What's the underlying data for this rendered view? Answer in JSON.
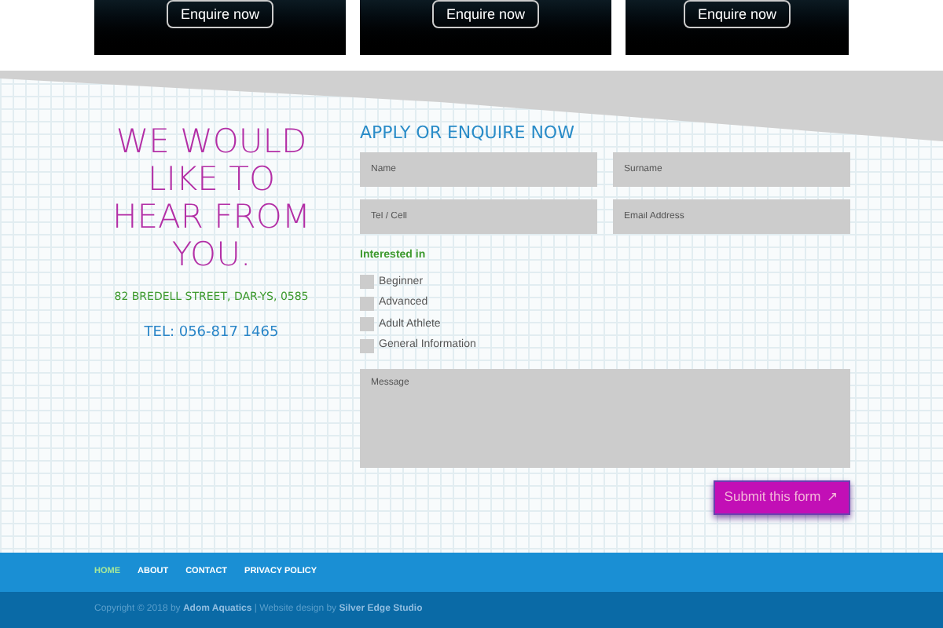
{
  "cards": [
    {
      "button": "Enquire now"
    },
    {
      "button": "Enquire now"
    },
    {
      "button": "Enquire now"
    }
  ],
  "contact": {
    "heading": "WE WOULD LIKE TO HEAR FROM YOU.",
    "address": "82 BREDELL STREET, DAR-YS, 0585",
    "tel": "TEL: 056-817 1465"
  },
  "form": {
    "title": "APPLY OR ENQUIRE NOW",
    "fields": [
      {
        "placeholder": "Name"
      },
      {
        "placeholder": "Surname"
      },
      {
        "placeholder": "Tel / Cell"
      },
      {
        "placeholder": "Email Address"
      }
    ],
    "interest_label": "Interested in",
    "options": [
      {
        "label": "Beginner",
        "checked": false
      },
      {
        "label": "Advanced",
        "checked": false
      },
      {
        "label": "Adult Athlete",
        "checked": false
      },
      {
        "label": "General Information",
        "checked": false
      }
    ],
    "message": {
      "placeholder": "Message"
    },
    "submit": "Submit this form",
    "submit_icon": "↗"
  },
  "footer": {
    "nav": [
      {
        "label": "HOME",
        "selected": true
      },
      {
        "label": "ABOUT",
        "selected": false
      },
      {
        "label": "CONTACT",
        "selected": false
      },
      {
        "label": "PRIVACY POLICY",
        "selected": false
      }
    ],
    "copyright": "Copyright © 2018 by **Adom Aquatics** | Website design by **Silver Edge Studio**"
  }
}
